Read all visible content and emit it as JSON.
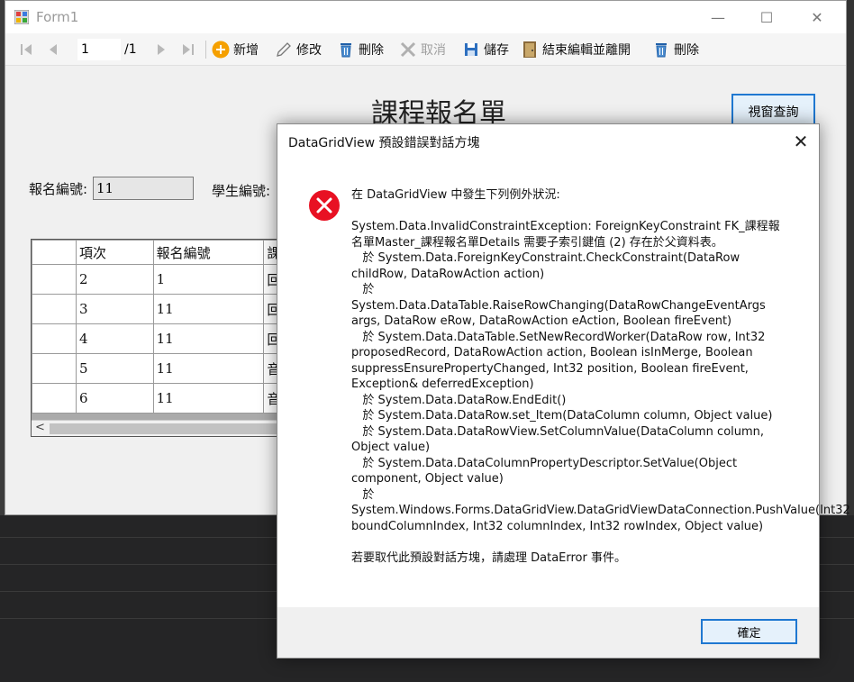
{
  "window": {
    "title": "Form1",
    "minimize": "—",
    "maximize": "☐",
    "close": "✕"
  },
  "toolbar": {
    "position": "1",
    "count": "/1",
    "add_label": "新增",
    "edit_label": "修改",
    "delete_label": "刪除",
    "cancel_label": "取消",
    "save_label": "儲存",
    "finish_label": "結束編輯並離開",
    "delete2_label": "刪除"
  },
  "form": {
    "heading": "課程報名單",
    "query_button": "視窗查詢",
    "reg_no_label": "報名編號:",
    "reg_no_value": "11",
    "student_no_label": "學生編號:"
  },
  "grid": {
    "columns": [
      "項次",
      "報名編號",
      "課"
    ],
    "rows": [
      [
        "2",
        "1",
        "回"
      ],
      [
        "3",
        "11",
        "回"
      ],
      [
        "4",
        "11",
        "回"
      ],
      [
        "5",
        "11",
        "音"
      ],
      [
        "6",
        "11",
        "音"
      ]
    ],
    "scroll_left": "<"
  },
  "dialog": {
    "title": "DataGridView 預設錯誤對話方塊",
    "close": "✕",
    "message": "在 DataGridView 中發生下列例外狀況:\n\nSystem.Data.InvalidConstraintException: ForeignKeyConstraint FK_課程報名單Master_課程報名單Details 需要子索引鍵值 (2) 存在於父資料表。\n   於 System.Data.ForeignKeyConstraint.CheckConstraint(DataRow childRow, DataRowAction action)\n   於\nSystem.Data.DataTable.RaiseRowChanging(DataRowChangeEventArgs args, DataRow eRow, DataRowAction eAction, Boolean fireEvent)\n   於 System.Data.DataTable.SetNewRecordWorker(DataRow row, Int32 proposedRecord, DataRowAction action, Boolean isInMerge, Boolean suppressEnsurePropertyChanged, Int32 position, Boolean fireEvent, Exception& deferredException)\n   於 System.Data.DataRow.EndEdit()\n   於 System.Data.DataRow.set_Item(DataColumn column, Object value)\n   於 System.Data.DataRowView.SetColumnValue(DataColumn column, Object value)\n   於 System.Data.DataColumnPropertyDescriptor.SetValue(Object component, Object value)\n   於\nSystem.Windows.Forms.DataGridView.DataGridViewDataConnection.PushValue(Int32 boundColumnIndex, Int32 columnIndex, Int32 rowIndex, Object value)\n\n若要取代此預設對話方塊，請處理 DataError 事件。",
    "ok_button": "確定"
  },
  "icons": {
    "app": "form-app-icon",
    "error": "error-icon",
    "accent_color": "#1f78d1",
    "error_color": "#e81123"
  }
}
